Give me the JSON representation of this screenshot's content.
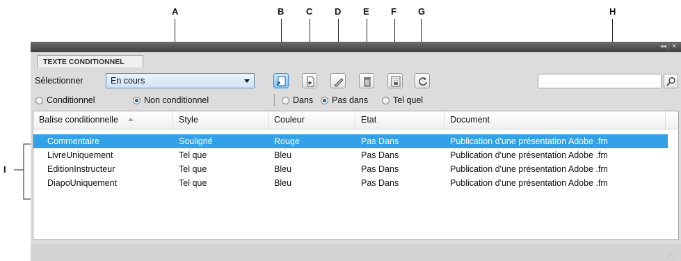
{
  "callouts": {
    "a": "A",
    "b": "B",
    "c": "C",
    "d": "D",
    "e": "E",
    "f": "F",
    "g": "G",
    "h": "H",
    "i": "I"
  },
  "panel": {
    "tab_label": "TEXTE CONDITIONNEL",
    "collapse_icon": "double-left-arrow-icon",
    "close_icon": "close-icon"
  },
  "selector": {
    "label": "Sélectionner",
    "value": "En cours"
  },
  "toolbar": {
    "buttons": [
      {
        "name": "apply-condition-button",
        "icon": "apply-tag-icon",
        "active": true
      },
      {
        "name": "new-condition-button",
        "icon": "new-document-icon"
      },
      {
        "name": "edit-condition-button",
        "icon": "pencil-icon"
      },
      {
        "name": "delete-condition-button",
        "icon": "trash-icon"
      },
      {
        "name": "show-hide-button",
        "icon": "show-hide-icon"
      },
      {
        "name": "refresh-button",
        "icon": "refresh-icon"
      }
    ]
  },
  "search": {
    "value": "",
    "icon": "search-icon"
  },
  "filters": {
    "conditional": "Conditionnel",
    "unconditional": "Non conditionnel",
    "in": "Dans",
    "not_in": "Pas dans",
    "as_is": "Tel quel",
    "selected_type": "Non conditionnel",
    "selected_scope": "Pas dans"
  },
  "table": {
    "columns": [
      "Balise conditionnelle",
      "Style",
      "Couleur",
      "Etat",
      "Document"
    ],
    "rows": [
      [
        "Commentaire",
        "Souligné",
        "Rouge",
        "Pas Dans",
        "Publication d'une présentation Adobe .fm"
      ],
      [
        "LivreUniquement",
        "Tel que",
        "Bleu",
        "Pas Dans",
        "Publication d'une présentation Adobe .fm"
      ],
      [
        "EditionInstructeur",
        "Tel que",
        "Bleu",
        "Pas Dans",
        "Publication d'une présentation Adobe .fm"
      ],
      [
        "DiapoUniquement",
        "Tel que",
        "Bleu",
        "Pas Dans",
        "Publication d'une présentation Adobe .fm"
      ]
    ],
    "selected_row": 0
  },
  "colors": {
    "selection": "#33a0ea",
    "titlebar": "#4a4a4a",
    "panel": "#dcdcdc"
  }
}
